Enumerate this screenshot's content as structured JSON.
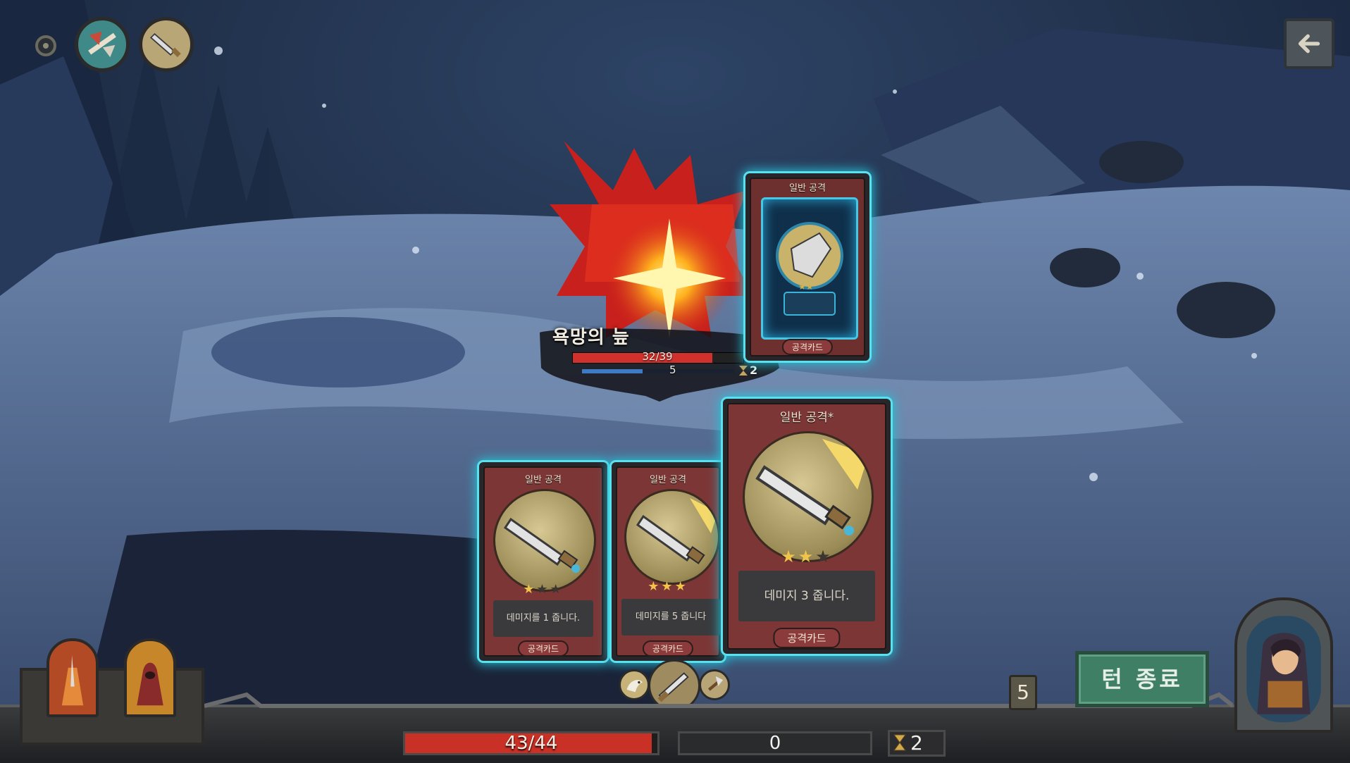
{
  "colors": {
    "sky": "#1d2c44",
    "snow": "#5d77a0",
    "card_glow": "#5be0ee",
    "card_body": "#7c3636",
    "hp_red": "#d0312d",
    "shield_blue": "#3f7bc4",
    "end_turn_green": "#3f7f66",
    "star_gold": "#f0c34a"
  },
  "top_bar": {
    "relics": [
      {
        "icon": "settings-dot-icon"
      },
      {
        "icon": "axe-relic-icon"
      },
      {
        "icon": "sword-relic-icon"
      }
    ],
    "back_icon": "back-arrow-icon"
  },
  "enemy": {
    "name": "욕망의 늪",
    "hp_text": "32/39",
    "hp_fraction": 0.82,
    "shield": "5",
    "shield_fraction": 0.4,
    "intent_icon": "hourglass-icon",
    "intent_value": "2"
  },
  "cards": [
    {
      "id": "played-card",
      "title": "일반 공격",
      "type_label": "공격카드",
      "stars_on": 2,
      "stars_total": 2,
      "description": "",
      "art_icon": "fist-gauntlet-icon"
    },
    {
      "id": "hand-card-1",
      "title": "일반 공격",
      "type_label": "공격카드",
      "stars_on": 1,
      "stars_total": 3,
      "description": "데미지를 1 줍니다.",
      "art_icon": "sword-icon"
    },
    {
      "id": "hand-card-2",
      "title": "일반 공격",
      "type_label": "공격카드",
      "stars_on": 3,
      "stars_total": 3,
      "description": "데미지를 5 줍니다",
      "art_icon": "sword-icon"
    },
    {
      "id": "hand-card-3",
      "title": "일반 공격*",
      "type_label": "공격카드",
      "stars_on": 2,
      "stars_total": 3,
      "description": "데미지 3 줍니다.",
      "art_icon": "sword-icon"
    }
  ],
  "player": {
    "hp_text": "43/44",
    "hp_fraction": 0.977,
    "block": "0",
    "energy": "2",
    "energy_icon": "hourglass-icon"
  },
  "deck": {
    "count": "5",
    "icons": [
      "eagle-icon",
      "sword-icon",
      "axe-icon"
    ]
  },
  "end_turn_label": "턴 종료",
  "portraits": {
    "left": [
      "warrior-portrait-icon",
      "hooded-mage-portrait-icon"
    ],
    "right": "rogue-portrait-icon"
  }
}
